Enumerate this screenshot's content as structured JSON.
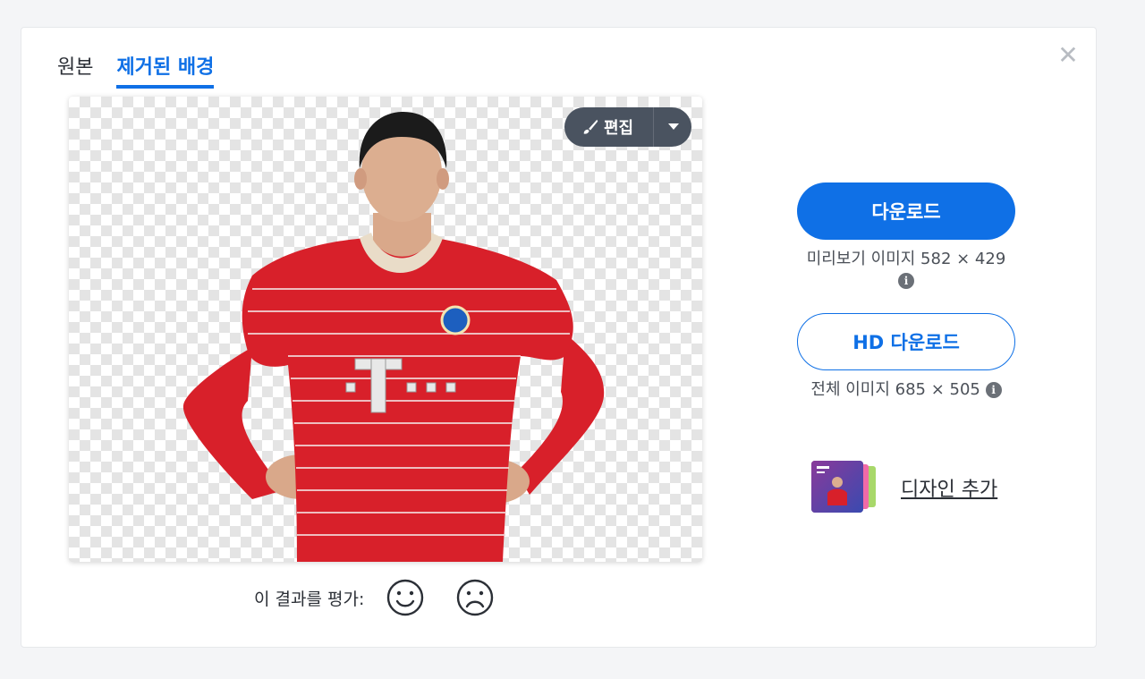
{
  "tabs": [
    {
      "label": "원본",
      "active": false
    },
    {
      "label": "제거된 배경",
      "active": true
    }
  ],
  "close_label": "✕",
  "editor": {
    "edit_label": "편집"
  },
  "rating": {
    "prompt": "이 결과를 평가:"
  },
  "download": {
    "button_label": "다운로드",
    "preview_text": "미리보기 이미지 582 × 429",
    "hd_button_label": "HD 다운로드",
    "full_text": "전체 이미지 685 × 505"
  },
  "design": {
    "link_label": "디자인 추가"
  },
  "colors": {
    "accent": "#0f70e6",
    "jersey": "#d8202a",
    "edit_btn": "#4a5360"
  },
  "icons": [
    "brush-icon",
    "chevron-down-icon",
    "close-icon",
    "info-icon",
    "smile-face-icon",
    "frown-face-icon"
  ]
}
